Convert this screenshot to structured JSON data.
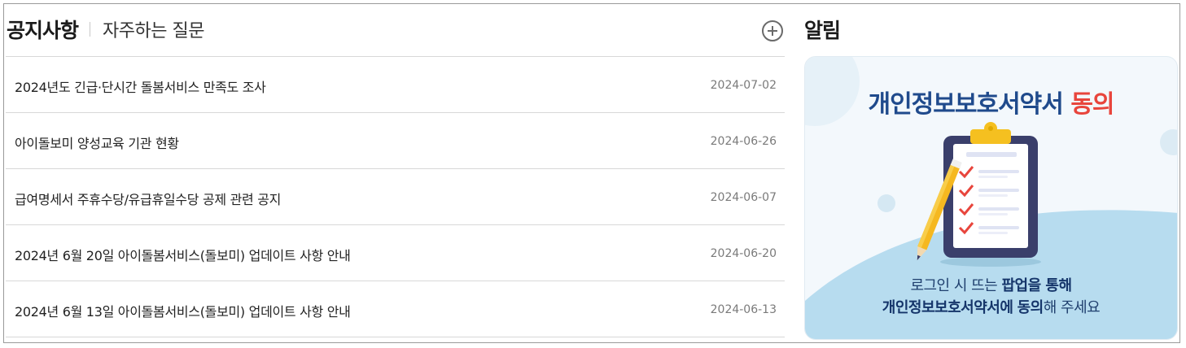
{
  "notice": {
    "tab_active": "공지사항",
    "tab_inactive": "자주하는 질문",
    "items": [
      {
        "title": "2024년도 긴급·단시간 돌봄서비스 만족도 조사",
        "date": "2024-07-02"
      },
      {
        "title": "아이돌보미 양성교육 기관 현황",
        "date": "2024-06-26"
      },
      {
        "title": "급여명세서 주휴수당/유급휴일수당 공제 관련 공지",
        "date": "2024-06-07"
      },
      {
        "title": "2024년 6월 20일 아이돌봄서비스(돌보미) 업데이트 사항 안내",
        "date": "2024-06-20"
      },
      {
        "title": "2024년 6월 13일 아이돌봄서비스(돌보미) 업데이트 사항 안내",
        "date": "2024-06-13"
      }
    ]
  },
  "alarm": {
    "title": "알림",
    "banner": {
      "heading_main": "개인정보보호서약서",
      "heading_accent": "동의",
      "line1_pre": "로그인 시 뜨는",
      "line1_bold": "팝업을 통해",
      "line2_bold1": "개인정보보호서약서에",
      "line2_bold2": "동의",
      "line2_post": "해 주세요"
    }
  },
  "colors": {
    "banner_blue": "#1f4a8c",
    "banner_red": "#e8453c",
    "banner_bg": "#f3f8fc",
    "banner_wave": "#b7dcef"
  },
  "icons": {
    "more": "plus-circle-icon",
    "clipboard": "clipboard-checklist-icon",
    "pencil": "pencil-icon"
  }
}
